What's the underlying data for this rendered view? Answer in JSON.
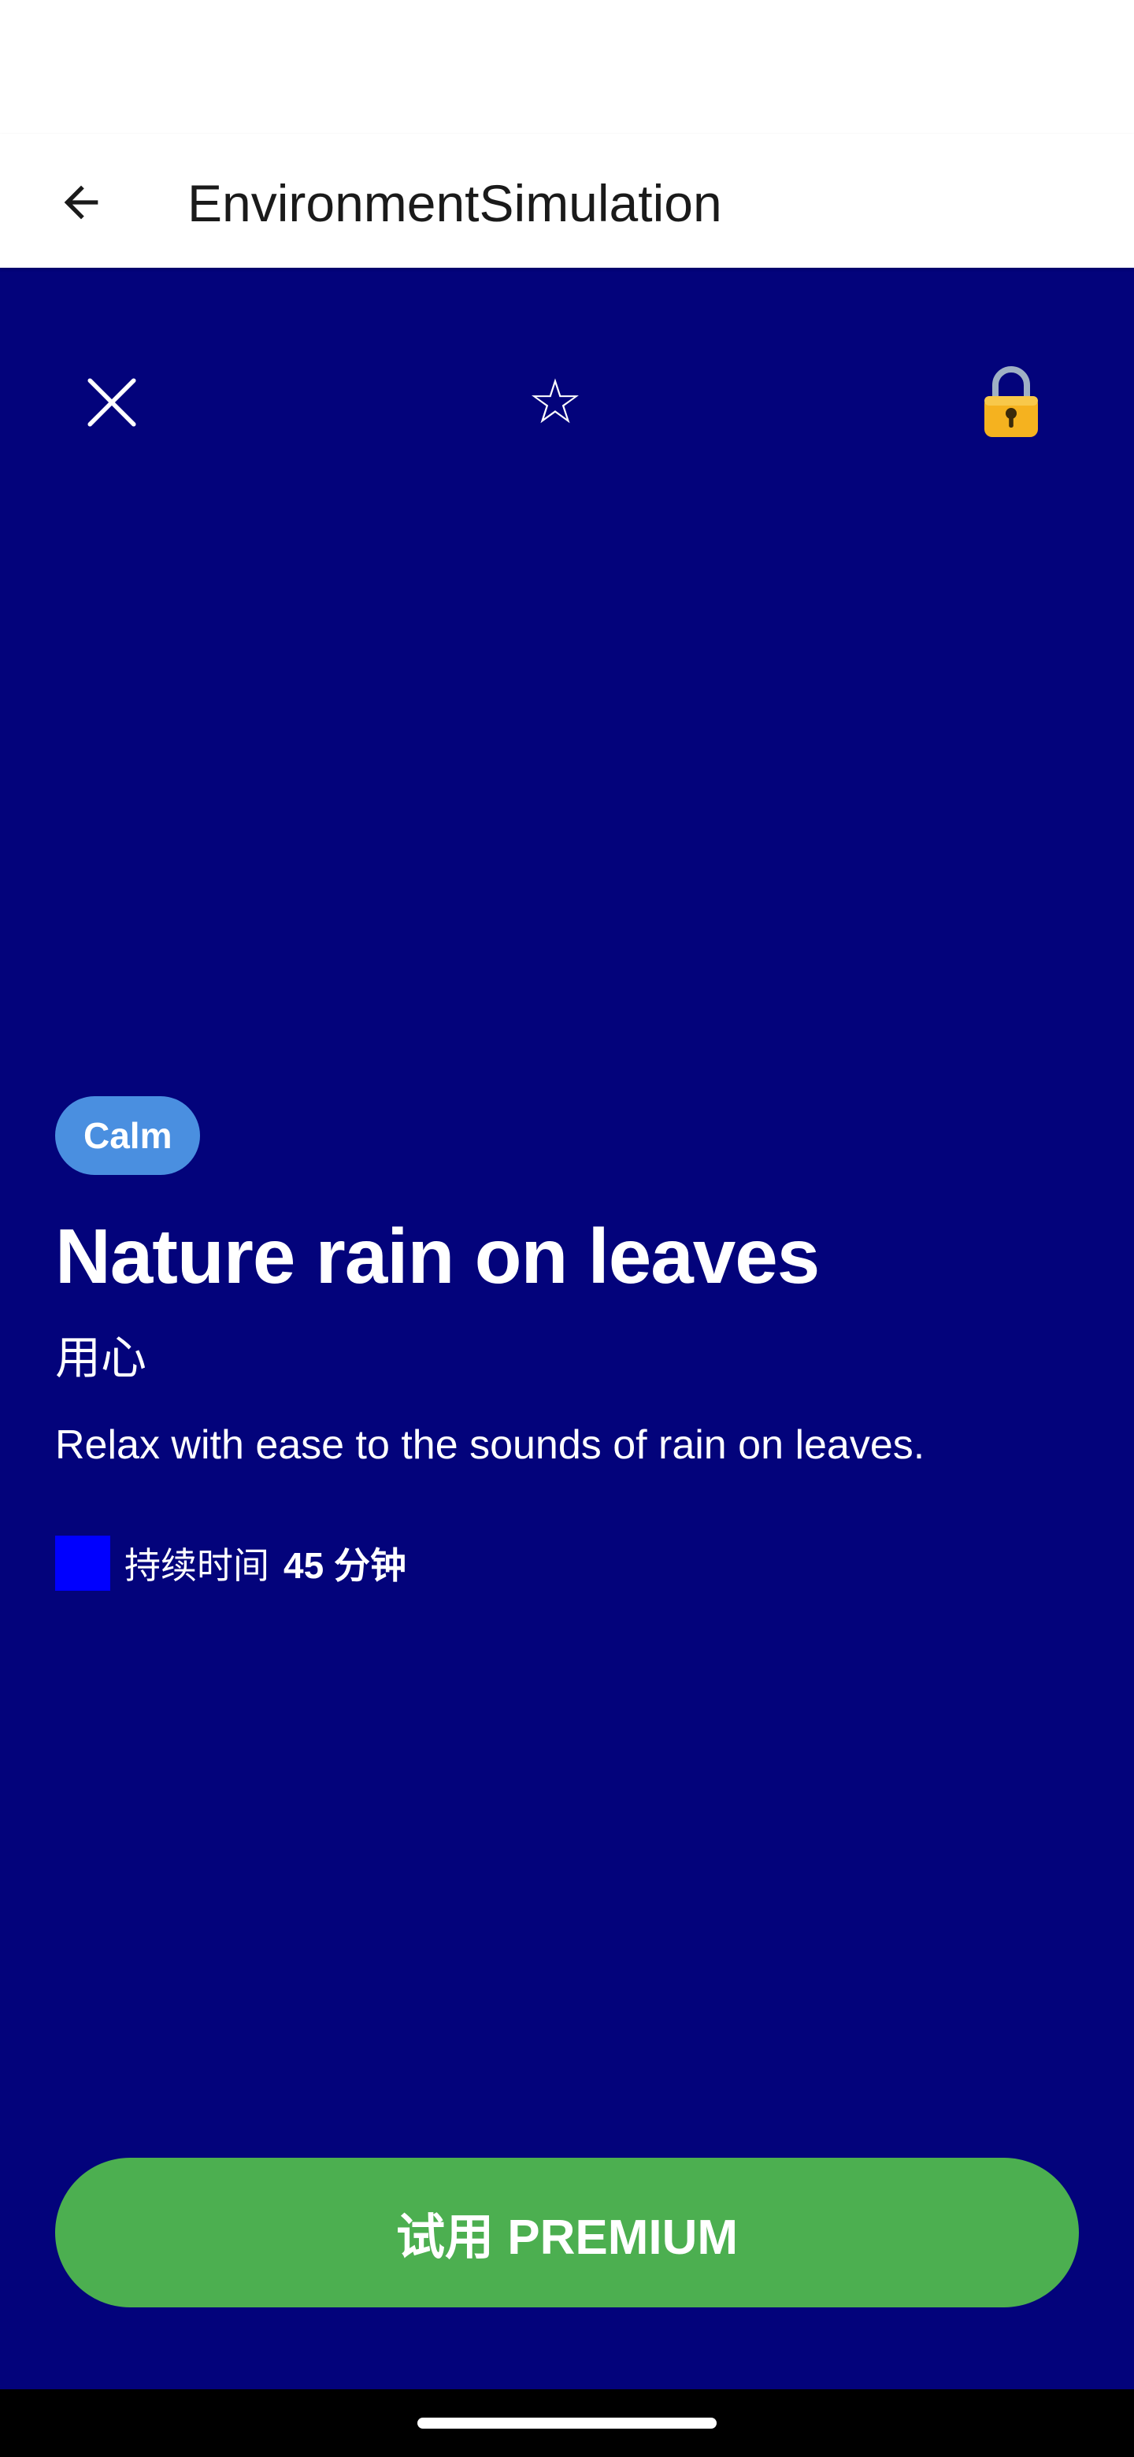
{
  "app_bar": {
    "title": "EnvironmentSimulation",
    "back_icon": "arrow-left-icon"
  },
  "top_controls": {
    "close_icon": "close-icon",
    "star_icon": "star-outline-icon",
    "star_glyph": "☆",
    "lock_icon": "lock-icon",
    "lock_glyph": "🔒"
  },
  "session": {
    "tag": "Calm",
    "title": "Nature rain on leaves",
    "subtitle": "用心",
    "description": "Relax with ease to the sounds of rain on leaves.",
    "duration_label": "持续时间",
    "duration_value": "45 分钟"
  },
  "premium_button": {
    "label": "试用 PREMIUM"
  },
  "colors": {
    "background": "#03037b",
    "tag": "#4a8fe0",
    "premium": "#4caf50",
    "duration_swatch": "#0000ff"
  }
}
